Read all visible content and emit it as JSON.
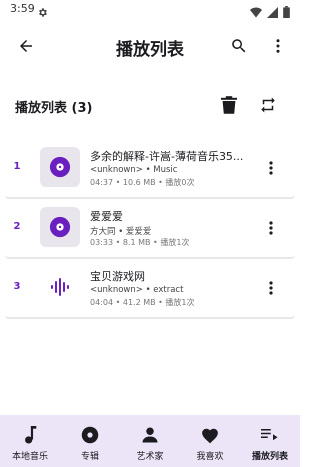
{
  "status_bar": {
    "time": "3:59",
    "icons": [
      "settings-icon",
      "wifi-icon",
      "signal-icon",
      "battery-icon"
    ]
  },
  "header": {
    "title": "播放列表",
    "icons": [
      "back-arrow-icon",
      "search-icon",
      "more-vert-icon"
    ]
  },
  "playlist": {
    "title": "播放列表 (3)",
    "actions": [
      "delete-icon",
      "repeat-icon"
    ],
    "tracks": [
      {
        "index": "1",
        "title": "多余的解释-许嵩-薄荷音乐35...",
        "artist_line": "<unknown> • Music",
        "meta_line": "04:37 • 10.6 MB • 播放0次",
        "art": "vinyl-disc-icon"
      },
      {
        "index": "2",
        "title": "爱爱爱",
        "artist_line": "方大同 • 爱爱爱",
        "meta_line": "03:33 • 8.1 MB • 播放1次",
        "art": "vinyl-disc-icon"
      },
      {
        "index": "3",
        "title": "宝贝游戏网",
        "artist_line": "<unknown> • extract",
        "meta_line": "04:04 • 41.2 MB • 播放1次",
        "art": "audio-wave-icon"
      }
    ]
  },
  "bottom_nav": {
    "items": [
      {
        "label": "本地音乐",
        "icon": "music-note-icon",
        "active": false
      },
      {
        "label": "专辑",
        "icon": "album-icon",
        "active": false
      },
      {
        "label": "艺术家",
        "icon": "person-icon",
        "active": false
      },
      {
        "label": "我喜欢",
        "icon": "heart-icon",
        "active": false
      },
      {
        "label": "播放列表",
        "icon": "queue-music-icon",
        "active": true
      }
    ]
  },
  "colors": {
    "accent": "#6a1fbf",
    "nav_background": "#ece4f7",
    "art_background": "#e8e6ec"
  }
}
